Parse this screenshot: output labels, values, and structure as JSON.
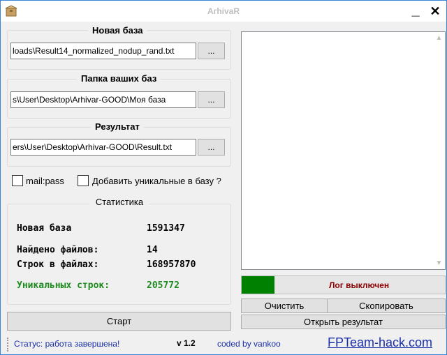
{
  "window": {
    "title": "ArhivaR",
    "minimize_label": "_",
    "close_label": "✕"
  },
  "new_base": {
    "title": "Новая база",
    "path": "loads\\Result14_normalized_nodup_rand.txt",
    "browse_label": "..."
  },
  "bases_folder": {
    "title": "Папка ваших баз",
    "path": "s\\User\\Desktop\\Arhivar-GOOD\\Моя база",
    "browse_label": "..."
  },
  "result": {
    "title": "Результат",
    "path": "ers\\User\\Desktop\\Arhivar-GOOD\\Result.txt",
    "browse_label": "..."
  },
  "options": {
    "mailpass_label": "mail:pass",
    "add_unique_label": "Добавить уникальные в базу ?"
  },
  "stats": {
    "title": "Статистика",
    "new_base_label": "Новая база",
    "new_base_value": "1591347",
    "files_found_label": "Найдено файлов:",
    "files_found_value": "14",
    "lines_label": "Строк в файлах:",
    "lines_value": "168957870",
    "unique_label": "Уникальных строк:",
    "unique_value": "205772"
  },
  "start_label": "Старт",
  "log": {
    "status": "Лог выключен",
    "progress_percent": 16
  },
  "buttons": {
    "clear": "Очистить",
    "copy": "Скопировать",
    "open_result": "Открыть результат"
  },
  "statusbar": {
    "status": "Статус:  работа завершена!",
    "version": "v 1.2",
    "coded_by": "coded by vankoo",
    "site": "FPTeam-hack.com"
  }
}
